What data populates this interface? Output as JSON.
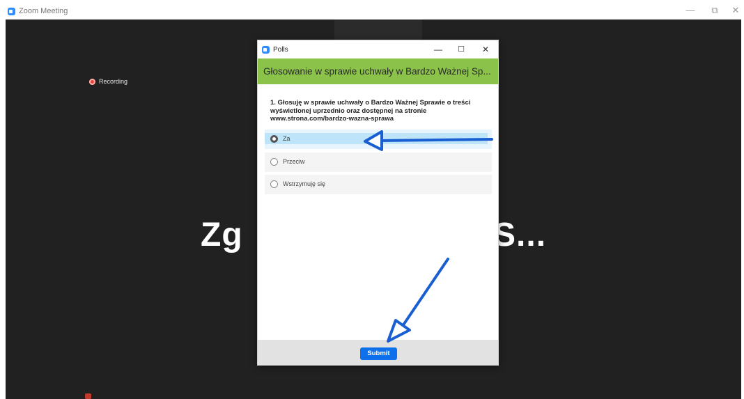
{
  "app": {
    "window_title": "Zoom Meeting",
    "controls": {
      "minimize": "—",
      "maximize": "⧉",
      "close": "✕"
    }
  },
  "meeting": {
    "recording_label": "Recording",
    "shared_text_left": "Zg",
    "shared_text_right": "S..."
  },
  "polls": {
    "window_title": "Polls",
    "controls": {
      "minimize": "—",
      "maximize": "☐",
      "close": "✕"
    },
    "poll_title": "Głosowanie w sprawie uchwały w Bardzo Ważnej Sp...",
    "question": "1. Głosuję w sprawie uchwały o Bardzo Ważnej Sprawie o treści wyświetlonej uprzednio oraz dostępnej na stronie www.strona.com/bardzo-wazna-sprawa",
    "options": [
      {
        "label": "Za",
        "selected": true
      },
      {
        "label": "Przeciw",
        "selected": false
      },
      {
        "label": "Wstrzymuję się",
        "selected": false
      }
    ],
    "submit_label": "Submit"
  },
  "colors": {
    "poll_header": "#8bc34a",
    "submit_button": "#0e71eb",
    "meeting_bg": "#212121",
    "annotation_arrow": "#1a5fd1",
    "selection_highlight": "#bde4f9"
  },
  "icons": {
    "zoom_logo": "zoom-logo-icon",
    "recording": "recording-dot-icon",
    "radio_selected": "radio-selected-icon",
    "radio_unselected": "radio-unselected-icon"
  }
}
